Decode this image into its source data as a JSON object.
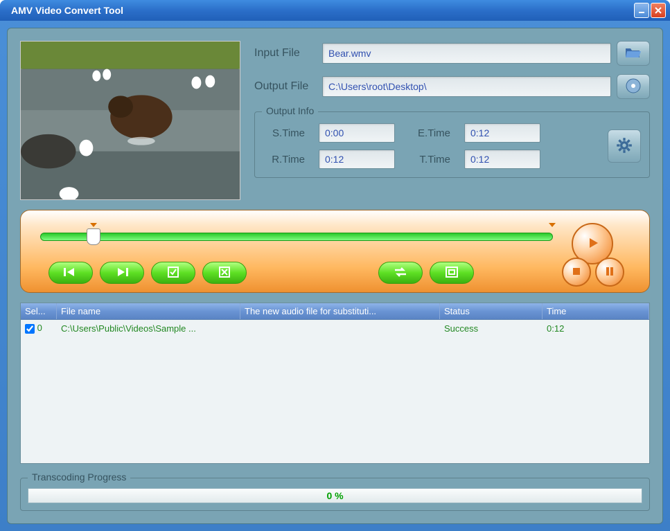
{
  "title": "AMV Video Convert Tool",
  "input": {
    "label": "Input File",
    "value": "Bear.wmv"
  },
  "output": {
    "label": "Output File",
    "value": "C:\\Users\\root\\Desktop\\"
  },
  "output_info": {
    "legend": "Output Info",
    "s_time": {
      "label": "S.Time",
      "value": "0:00"
    },
    "e_time": {
      "label": "E.Time",
      "value": "0:12"
    },
    "r_time": {
      "label": "R.Time",
      "value": "0:12"
    },
    "t_time": {
      "label": "T.Time",
      "value": "0:12"
    }
  },
  "table": {
    "headers": {
      "sel": "Sel...",
      "filename": "File name",
      "audio": "The new audio file for substituti...",
      "status": "Status",
      "time": "Time"
    },
    "rows": [
      {
        "checked": true,
        "index": "0",
        "filename": "C:\\Users\\Public\\Videos\\Sample ...",
        "audio": "",
        "status": "Success",
        "time": "0:12"
      }
    ]
  },
  "progress": {
    "legend": "Transcoding Progress",
    "text": "0 %"
  }
}
